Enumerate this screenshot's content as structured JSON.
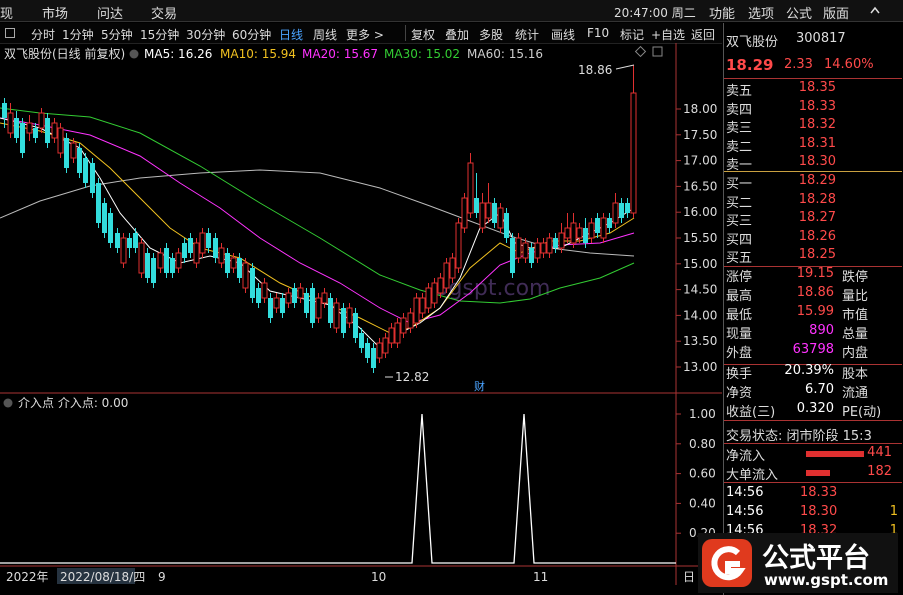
{
  "topbar": {
    "items": [
      "现",
      "市场",
      "问达",
      "交易",
      "功能",
      "选项",
      "公式",
      "版面"
    ],
    "clock": "20:47:00 周二"
  },
  "toolbar": {
    "periods": [
      "分时",
      "1分钟",
      "5分钟",
      "15分钟",
      "30分钟",
      "60分钟",
      "日线",
      "周线",
      "更多 >"
    ],
    "active_period": "日线",
    "actions": [
      "复权",
      "叠加",
      "多股",
      "统计",
      "画线",
      "F10",
      "标记",
      "+自选",
      "返回"
    ]
  },
  "main_chart": {
    "title": "双飞股份(日线 前复权)",
    "ma": [
      {
        "label": "MA5: 16.26",
        "color": "#ffffff"
      },
      {
        "label": "MA10: 15.94",
        "color": "#f0c020"
      },
      {
        "label": "MA20: 15.67",
        "color": "#ff33ff"
      },
      {
        "label": "MA30: 15.02",
        "color": "#33cc33"
      },
      {
        "label": "MA60: 15.16",
        "color": "#cccccc"
      }
    ],
    "high_marker": "18.86",
    "low_marker": "12.82",
    "fin_marker": "财",
    "watermark": "ogspt.com",
    "y_ticks": [
      "18.00",
      "17.50",
      "17.00",
      "16.50",
      "16.00",
      "15.50",
      "15.00",
      "14.50",
      "14.00",
      "13.50",
      "13.00"
    ]
  },
  "sub_chart": {
    "title": "介入点  介入点: 0.00",
    "y_ticks": [
      "1.00",
      "0.80",
      "0.60",
      "0.40",
      "0.20"
    ]
  },
  "date_axis": {
    "labels": [
      "2022年",
      "2022/08/18/四",
      "9",
      "10",
      "11"
    ],
    "end_label": "日"
  },
  "right_panel": {
    "name": "双飞股份",
    "code": "300817",
    "price": "18.29",
    "change": "2.33",
    "change_pct": "14.60%",
    "asks": [
      {
        "label": "卖五",
        "price": "18.35"
      },
      {
        "label": "卖四",
        "price": "18.33"
      },
      {
        "label": "卖三",
        "price": "18.32"
      },
      {
        "label": "卖二",
        "price": "18.31"
      },
      {
        "label": "卖一",
        "price": "18.30"
      }
    ],
    "bids": [
      {
        "label": "买一",
        "price": "18.29"
      },
      {
        "label": "买二",
        "price": "18.28"
      },
      {
        "label": "买三",
        "price": "18.27"
      },
      {
        "label": "买四",
        "price": "18.26"
      },
      {
        "label": "买五",
        "price": "18.25"
      }
    ],
    "stats": [
      {
        "label": "涨停",
        "value": "19.15",
        "label2": "跌停"
      },
      {
        "label": "最高",
        "value": "18.86",
        "label2": "量比"
      },
      {
        "label": "最低",
        "value": "15.99",
        "label2": "市值"
      },
      {
        "label": "现量",
        "value": "890",
        "label2": "总量"
      },
      {
        "label": "外盘",
        "value": "63798",
        "label2": "内盘"
      }
    ],
    "stats2": [
      {
        "label": "换手",
        "value": "20.39%",
        "label2": "股本"
      },
      {
        "label": "净资",
        "value": "6.70",
        "label2": "流通"
      },
      {
        "label": "收益(三)",
        "value": "0.320",
        "label2": "PE(动)"
      }
    ],
    "status": "交易状态: 闭市阶段 15:3",
    "flows": [
      {
        "label": "净流入",
        "value": "441"
      },
      {
        "label": "大单流入",
        "value": "182"
      }
    ],
    "ticks": [
      {
        "time": "14:56",
        "price": "18.33",
        "vol": ""
      },
      {
        "time": "14:56",
        "price": "18.30",
        "vol": "1"
      },
      {
        "time": "14:56",
        "price": "18.32",
        "vol": "1"
      }
    ]
  },
  "logo": {
    "text": "公式平台",
    "url": "www.gspt.com"
  }
}
